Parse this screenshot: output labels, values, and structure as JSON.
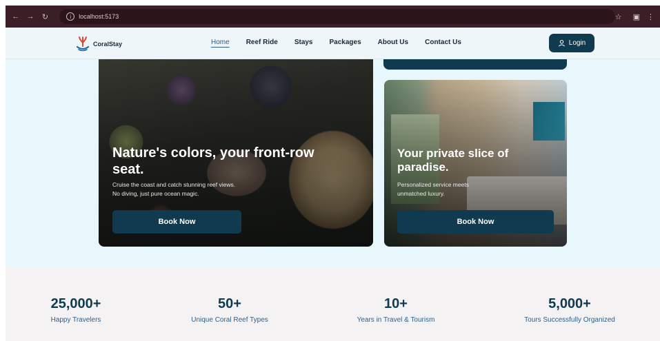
{
  "browser": {
    "url": "localhost:5173"
  },
  "nav": {
    "brand": "CoralStay",
    "links": [
      "Home",
      "Reef Ride",
      "Stays",
      "Packages",
      "About Us",
      "Contact Us"
    ],
    "active": "Home",
    "login_label": "Login"
  },
  "hero": {
    "reef_card": {
      "title": "Nature's colors, your front-row seat.",
      "description_line1": "Cruise the coast and catch stunning reef views.",
      "description_line2": "No diving, just pure ocean magic.",
      "button": "Book Now"
    },
    "stay_card": {
      "title": "Your private slice of paradise.",
      "description_line1": "Personalized service meets",
      "description_line2": "unmatched luxury.",
      "button": "Book Now"
    }
  },
  "stats": [
    {
      "value": "25,000+",
      "label": "Happy Travelers"
    },
    {
      "value": "50+",
      "label": "Unique Coral Reef Types"
    },
    {
      "value": "10+",
      "label": "Years in Travel & Tourism"
    },
    {
      "value": "5,000+",
      "label": "Tours Successfully Organized"
    }
  ],
  "colors": {
    "brand_dark": "#0f3a4f",
    "hero_bg": "#e8f7fc",
    "stats_bg": "#f4f2f2",
    "link_active": "#2c5f8a"
  },
  "icons": {
    "back": "arrow-left-icon",
    "forward": "arrow-right-icon",
    "reload": "reload-icon",
    "info": "info-icon",
    "bookmark": "star-icon",
    "login": "user-icon",
    "logo": "coral-logo-icon"
  }
}
